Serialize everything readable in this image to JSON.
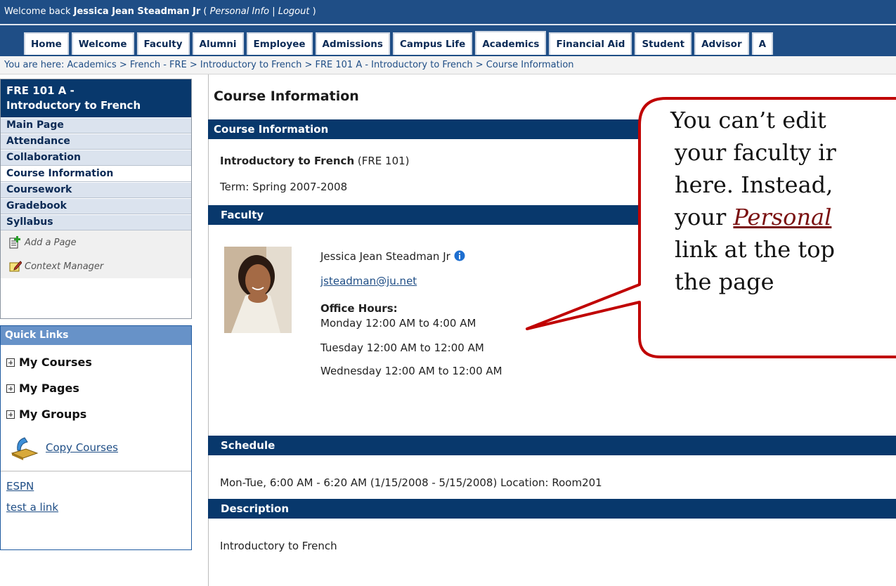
{
  "topbar": {
    "welcome": "Welcome back ",
    "user": "Jessica Jean Steadman Jr",
    "paren_open": " ( ",
    "personal_info": "Personal Info",
    "sep": " | ",
    "logout": "Logout",
    "paren_close": " )"
  },
  "tabs": [
    {
      "label": "Home"
    },
    {
      "label": "Welcome"
    },
    {
      "label": "Faculty"
    },
    {
      "label": "Alumni"
    },
    {
      "label": "Employee"
    },
    {
      "label": "Admissions"
    },
    {
      "label": "Campus Life"
    },
    {
      "label": "Academics"
    },
    {
      "label": "Financial Aid"
    },
    {
      "label": "Student"
    },
    {
      "label": "Advisor"
    },
    {
      "label": "A"
    }
  ],
  "breadcrumb": "You are here:  Academics > French - FRE > Introductory to French > FRE 101 A - Introductory to French > Course Information",
  "sidebar": {
    "course_title_line1": "FRE 101 A -",
    "course_title_line2": "Introductory to French",
    "items": [
      {
        "label": "Main Page"
      },
      {
        "label": "Attendance"
      },
      {
        "label": "Collaboration"
      },
      {
        "label": "Course Information"
      },
      {
        "label": "Coursework"
      },
      {
        "label": "Gradebook"
      },
      {
        "label": "Syllabus"
      }
    ],
    "add_page": "Add a Page",
    "context_manager": "Context Manager"
  },
  "quick_links": {
    "heading": "Quick Links",
    "my_courses": "My Courses",
    "my_pages": "My Pages",
    "my_groups": "My Groups",
    "copy_courses": "Copy Courses",
    "links": [
      "ESPN",
      "test a link"
    ]
  },
  "main": {
    "page_title": "Course Information",
    "course_info_header": "Course Information",
    "course_name": "Introductory to French",
    "course_code": " (FRE 101)",
    "term": "Term: Spring 2007-2008",
    "faculty_header": "Faculty",
    "faculty_name": "Jessica Jean Steadman Jr",
    "faculty_email": "jsteadman@ju.net",
    "office_hours_label": "Office Hours:",
    "office_hours": [
      "Monday 12:00 AM to 4:00 AM",
      "Tuesday 12:00 AM to 12:00 AM",
      "Wednesday 12:00 AM to 12:00 AM"
    ],
    "schedule_header": "Schedule",
    "schedule_text": "Mon-Tue, 6:00 AM - 6:20 AM (1/15/2008 - 5/15/2008) Location: Room201",
    "description_header": "Description",
    "description_text": "Introductory to French"
  },
  "callout": {
    "line1": "You can’t edit",
    "line2": "your faculty ir",
    "line3": "here.  Instead,",
    "line4_pre": "your ",
    "line4_link": "Personal",
    "line5": "link at the top",
    "line6": "the page"
  },
  "colors": {
    "header_blue": "#1f4e86",
    "section_blue": "#08386c",
    "callout_border": "#c00000"
  }
}
